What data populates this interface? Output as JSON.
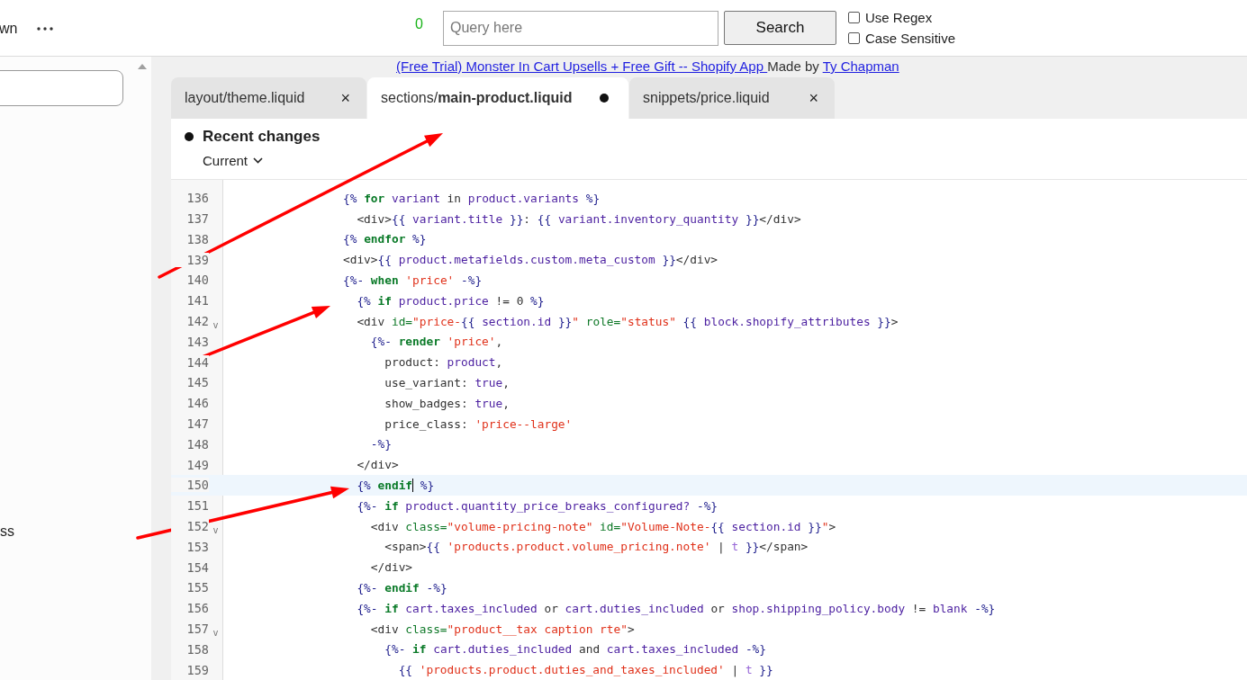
{
  "topbar": {
    "cut_label": "wn",
    "match_count": "0",
    "search": {
      "placeholder": "Query here"
    },
    "search_button": "Search",
    "options": [
      {
        "label": "Use Regex",
        "checked": false
      },
      {
        "label": "Case Sensitive",
        "checked": false
      }
    ]
  },
  "sidebar": {
    "cut_item": "ss"
  },
  "credit": {
    "app_link": "(Free Trial) Monster In Cart Upsells + Free Gift -- Shopify App ",
    "made_by": "Made by ",
    "author_link": "Ty Chapman"
  },
  "tabs": [
    {
      "label": "layout/theme.liquid",
      "selected": false,
      "modified": false,
      "close": "×"
    },
    {
      "label": "sections/**main-product.liquid**",
      "selected": true,
      "modified": true
    },
    {
      "label": "snippets/price.liquid",
      "selected": false,
      "modified": false,
      "close": "×"
    }
  ],
  "recent_changes": {
    "title": "Recent changes",
    "version": "Current"
  },
  "code_lines": [
    {
      "number": "136",
      "current": false,
      "tokens": [
        {
          "kind": "delim",
          "text": "{% "
        },
        {
          "kind": "keyword",
          "text": "for"
        },
        {
          "kind": "var",
          "text": " variant"
        },
        {
          "kind": "text",
          "text": " in "
        },
        {
          "kind": "var",
          "text": "product.variants"
        },
        {
          "kind": "delim",
          "text": " %}"
        }
      ]
    },
    {
      "number": "137",
      "current": false,
      "tokens": [
        {
          "kind": "text",
          "text": "  <div>"
        },
        {
          "kind": "delim",
          "text": "{{ "
        },
        {
          "kind": "var",
          "text": "variant.title"
        },
        {
          "kind": "delim",
          "text": " }}"
        },
        {
          "kind": "text",
          "text": ": "
        },
        {
          "kind": "delim",
          "text": "{{ "
        },
        {
          "kind": "var",
          "text": "variant.inventory_quantity"
        },
        {
          "kind": "delim",
          "text": " }}"
        },
        {
          "kind": "text",
          "text": "</div>"
        }
      ]
    },
    {
      "number": "138",
      "current": false,
      "tokens": [
        {
          "kind": "delim",
          "text": "{% "
        },
        {
          "kind": "keyword",
          "text": "endfor"
        },
        {
          "kind": "delim",
          "text": " %}"
        }
      ]
    },
    {
      "number": "139",
      "current": false,
      "tokens": [
        {
          "kind": "text",
          "text": "<div>"
        },
        {
          "kind": "delim",
          "text": "{{ "
        },
        {
          "kind": "var",
          "text": "product.metafields.custom.meta_custom"
        },
        {
          "kind": "delim",
          "text": " }}"
        },
        {
          "kind": "text",
          "text": "</div>"
        }
      ]
    },
    {
      "number": "140",
      "current": false,
      "tokens": [
        {
          "kind": "delim",
          "text": "{%- "
        },
        {
          "kind": "keyword",
          "text": "when"
        },
        {
          "kind": "string",
          "text": " 'price'"
        },
        {
          "kind": "delim",
          "text": " -%}"
        }
      ]
    },
    {
      "number": "141",
      "current": false,
      "tokens": [
        {
          "kind": "delim",
          "text": "  {% "
        },
        {
          "kind": "keyword",
          "text": "if"
        },
        {
          "kind": "var",
          "text": " product.price"
        },
        {
          "kind": "text",
          "text": " != 0 "
        },
        {
          "kind": "delim",
          "text": "%}"
        }
      ]
    },
    {
      "number": "142",
      "current": false,
      "fold_marker": "v",
      "tokens": [
        {
          "kind": "text",
          "text": "  <div "
        },
        {
          "kind": "attr",
          "text": "id="
        },
        {
          "kind": "string",
          "text": "\"price-"
        },
        {
          "kind": "delim",
          "text": "{{ "
        },
        {
          "kind": "var",
          "text": "section.id"
        },
        {
          "kind": "delim",
          "text": " }}"
        },
        {
          "kind": "string",
          "text": "\""
        },
        {
          "kind": "attr",
          "text": " role="
        },
        {
          "kind": "string",
          "text": "\"status\""
        },
        {
          "kind": "delim",
          "text": " {{ "
        },
        {
          "kind": "var",
          "text": "block.shopify_attributes"
        },
        {
          "kind": "delim",
          "text": " }}"
        },
        {
          "kind": "text",
          "text": ">"
        }
      ]
    },
    {
      "number": "143",
      "current": false,
      "tokens": [
        {
          "kind": "delim",
          "text": "    {%- "
        },
        {
          "kind": "keyword",
          "text": "render"
        },
        {
          "kind": "string",
          "text": " 'price'"
        },
        {
          "kind": "text",
          "text": ","
        }
      ]
    },
    {
      "number": "144",
      "current": false,
      "tokens": [
        {
          "kind": "text",
          "text": "      product: "
        },
        {
          "kind": "var",
          "text": "product"
        },
        {
          "kind": "text",
          "text": ","
        }
      ]
    },
    {
      "number": "145",
      "current": false,
      "tokens": [
        {
          "kind": "text",
          "text": "      use_variant: "
        },
        {
          "kind": "var",
          "text": "true"
        },
        {
          "kind": "text",
          "text": ","
        }
      ]
    },
    {
      "number": "146",
      "current": false,
      "tokens": [
        {
          "kind": "text",
          "text": "      show_badges: "
        },
        {
          "kind": "var",
          "text": "true"
        },
        {
          "kind": "text",
          "text": ","
        }
      ]
    },
    {
      "number": "147",
      "current": false,
      "tokens": [
        {
          "kind": "text",
          "text": "      price_class: "
        },
        {
          "kind": "string",
          "text": "'price--large'"
        }
      ]
    },
    {
      "number": "148",
      "current": false,
      "tokens": [
        {
          "kind": "delim",
          "text": "    -%}"
        }
      ]
    },
    {
      "number": "149",
      "current": false,
      "tokens": [
        {
          "kind": "text",
          "text": "  </div>"
        }
      ]
    },
    {
      "number": "150",
      "current": true,
      "tokens": [
        {
          "kind": "delim",
          "text": "  {% "
        },
        {
          "kind": "keyword",
          "text": "endif",
          "cursor": true
        },
        {
          "kind": "delim",
          "text": " %}"
        }
      ]
    },
    {
      "number": "151",
      "current": false,
      "tokens": [
        {
          "kind": "delim",
          "text": "  {%- "
        },
        {
          "kind": "keyword",
          "text": "if"
        },
        {
          "kind": "var",
          "text": " product.quantity_price_breaks_configured?"
        },
        {
          "kind": "delim",
          "text": " -%}"
        }
      ]
    },
    {
      "number": "152",
      "current": false,
      "fold_marker": "v",
      "tokens": [
        {
          "kind": "text",
          "text": "    <div "
        },
        {
          "kind": "attr",
          "text": "class="
        },
        {
          "kind": "string",
          "text": "\"volume-pricing-note\""
        },
        {
          "kind": "attr",
          "text": " id="
        },
        {
          "kind": "string",
          "text": "\"Volume-Note-"
        },
        {
          "kind": "delim",
          "text": "{{ "
        },
        {
          "kind": "var",
          "text": "section.id"
        },
        {
          "kind": "delim",
          "text": " }}"
        },
        {
          "kind": "string",
          "text": "\""
        },
        {
          "kind": "text",
          "text": ">"
        }
      ]
    },
    {
      "number": "153",
      "current": false,
      "tokens": [
        {
          "kind": "text",
          "text": "      <span>"
        },
        {
          "kind": "delim",
          "text": "{{ "
        },
        {
          "kind": "string",
          "text": "'products.product.volume_pricing.note'"
        },
        {
          "kind": "text",
          "text": " | "
        },
        {
          "kind": "filter",
          "text": "t"
        },
        {
          "kind": "delim",
          "text": " }}"
        },
        {
          "kind": "text",
          "text": "</span>"
        }
      ]
    },
    {
      "number": "154",
      "current": false,
      "tokens": [
        {
          "kind": "text",
          "text": "    </div>"
        }
      ]
    },
    {
      "number": "155",
      "current": false,
      "tokens": [
        {
          "kind": "delim",
          "text": "  {%- "
        },
        {
          "kind": "keyword",
          "text": "endif"
        },
        {
          "kind": "delim",
          "text": " -%}"
        }
      ]
    },
    {
      "number": "156",
      "current": false,
      "tokens": [
        {
          "kind": "delim",
          "text": "  {%- "
        },
        {
          "kind": "keyword",
          "text": "if"
        },
        {
          "kind": "var",
          "text": " cart.taxes_included"
        },
        {
          "kind": "text",
          "text": " or "
        },
        {
          "kind": "var",
          "text": "cart.duties_included"
        },
        {
          "kind": "text",
          "text": " or "
        },
        {
          "kind": "var",
          "text": "shop.shipping_policy.body"
        },
        {
          "kind": "text",
          "text": " != "
        },
        {
          "kind": "var",
          "text": "blank"
        },
        {
          "kind": "delim",
          "text": " -%}"
        }
      ]
    },
    {
      "number": "157",
      "current": false,
      "fold_marker": "v",
      "tokens": [
        {
          "kind": "text",
          "text": "    <div "
        },
        {
          "kind": "attr",
          "text": "class="
        },
        {
          "kind": "string",
          "text": "\"product__tax caption rte\""
        },
        {
          "kind": "text",
          "text": ">"
        }
      ]
    },
    {
      "number": "158",
      "current": false,
      "tokens": [
        {
          "kind": "delim",
          "text": "      {%- "
        },
        {
          "kind": "keyword",
          "text": "if"
        },
        {
          "kind": "var",
          "text": " cart.duties_included"
        },
        {
          "kind": "text",
          "text": " and "
        },
        {
          "kind": "var",
          "text": "cart.taxes_included"
        },
        {
          "kind": "delim",
          "text": " -%}"
        }
      ]
    },
    {
      "number": "159",
      "current": false,
      "tokens": [
        {
          "kind": "delim",
          "text": "        {{ "
        },
        {
          "kind": "string",
          "text": "'products.product.duties_and_taxes_included'"
        },
        {
          "kind": "text",
          "text": " | "
        },
        {
          "kind": "filter",
          "text": "t"
        },
        {
          "kind": "delim",
          "text": " }}"
        }
      ]
    }
  ]
}
